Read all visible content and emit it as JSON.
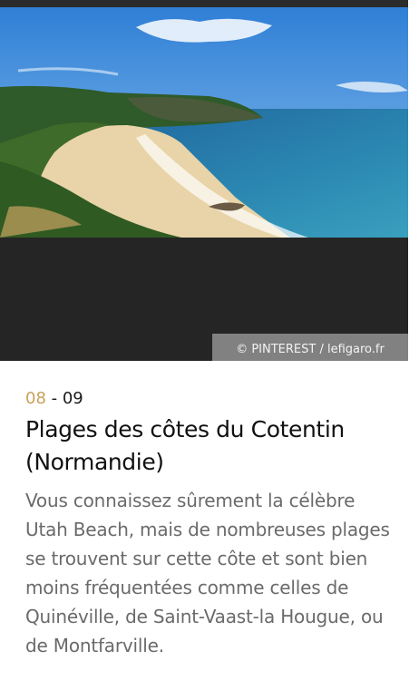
{
  "image": {
    "alt_icon": "coastline-photo",
    "credit": "© PINTEREST / lefigaro.fr"
  },
  "slide": {
    "current": "08",
    "separator": " - ",
    "total": "09"
  },
  "article": {
    "title": "Plages des côtes du Cotentin (Normandie)",
    "description": "Vous connaissez sûrement la célèbre Utah Beach, mais de nombreuses plages se trouvent sur cette côte et sont bien moins fréquentées comme celles de Quinéville, de Saint-Vaast-la Hougue, ou de Montfarville."
  },
  "colors": {
    "accent": "#c9a15a",
    "title": "#111111",
    "description": "#6a6a6a",
    "media_bg": "#252525"
  }
}
